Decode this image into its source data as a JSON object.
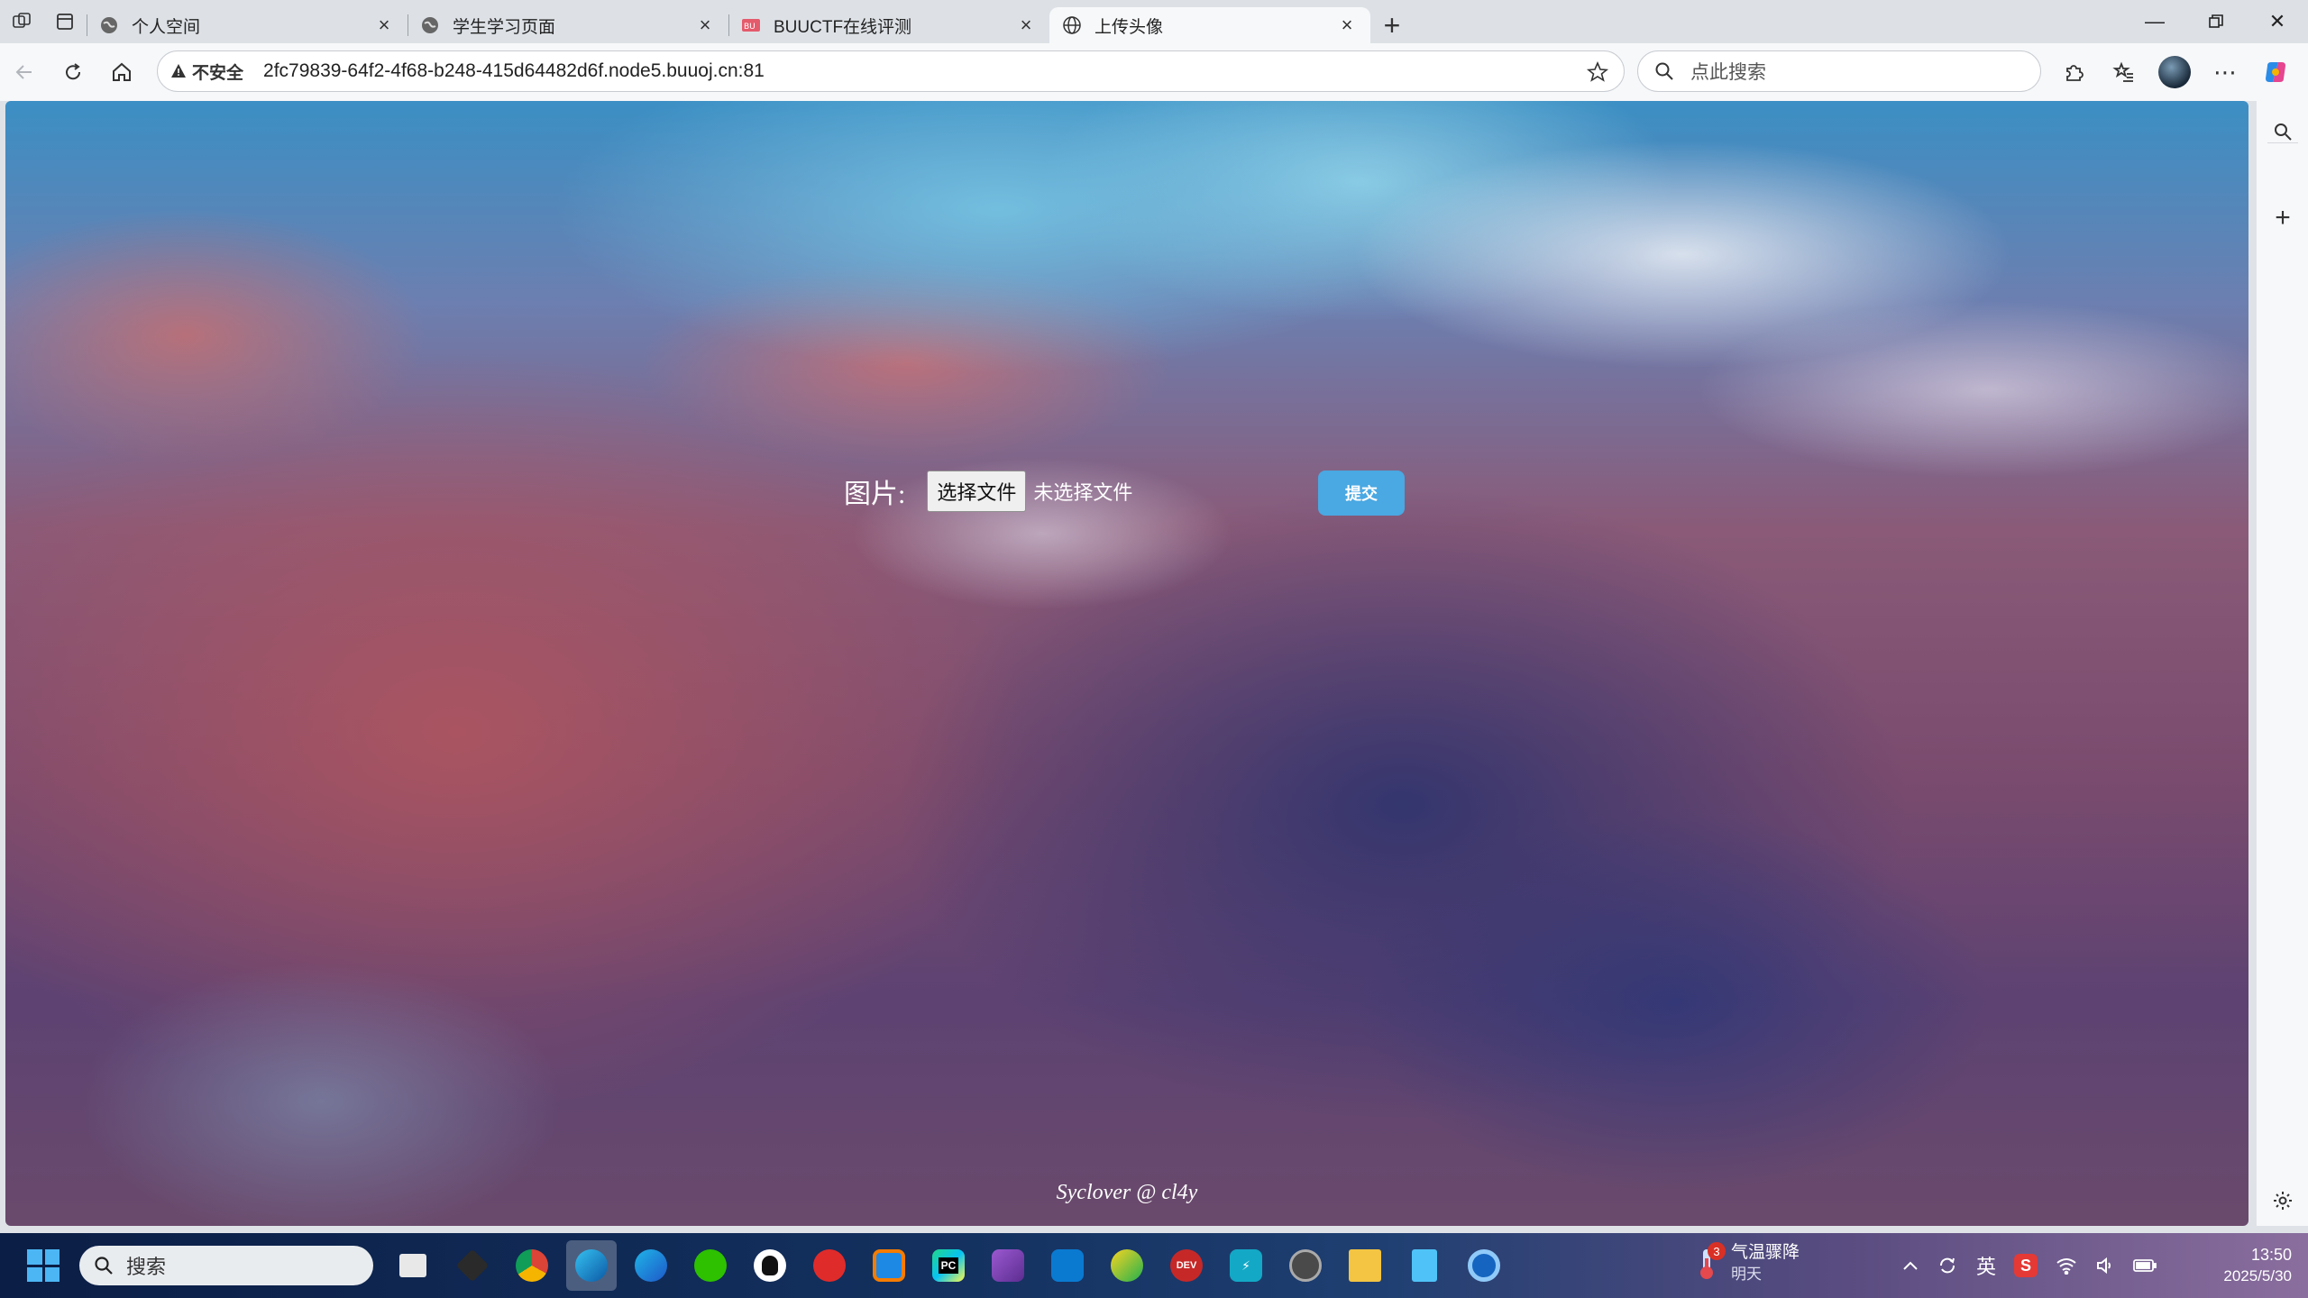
{
  "browser": {
    "tabs": [
      {
        "title": "个人空间",
        "icon": "globe-icon",
        "active": false
      },
      {
        "title": "学生学习页面",
        "icon": "globe-icon",
        "active": false
      },
      {
        "title": "BUUCTF在线评测",
        "icon": "buuctf-icon",
        "active": false
      },
      {
        "title": "上传头像",
        "icon": "globe-icon",
        "active": true
      }
    ],
    "address": {
      "security_label": "不安全",
      "url": "2fc79839-64f2-4f68-b248-415d64482d6f.node5.buuoj.cn:81"
    },
    "search_placeholder": "点此搜索"
  },
  "page": {
    "form_label": "图片:",
    "choose_file_label": "选择文件",
    "file_status": "未选择文件",
    "submit_label": "提交",
    "credit": "Syclover @ cl4y"
  },
  "taskbar": {
    "search_label": "搜索",
    "apps": [
      "file-explorer-icon",
      "cube-app-icon",
      "chrome-icon",
      "edge-icon",
      "edge-ai-icon",
      "wechat-icon",
      "qq-icon",
      "netease-music-icon",
      "box-app-icon",
      "pycharm-icon",
      "visual-studio-icon",
      "vscode-icon",
      "green-app-icon",
      "dev-cpp-icon",
      "bolt-app-icon",
      "clock-app-icon",
      "folder-icon",
      "notepad-icon",
      "chrome-alt-icon"
    ],
    "weather": {
      "badge": "3",
      "line1": "气温骤降",
      "line2": "明天"
    },
    "ime": "英",
    "time": "13:50",
    "date": "2025/5/30"
  }
}
